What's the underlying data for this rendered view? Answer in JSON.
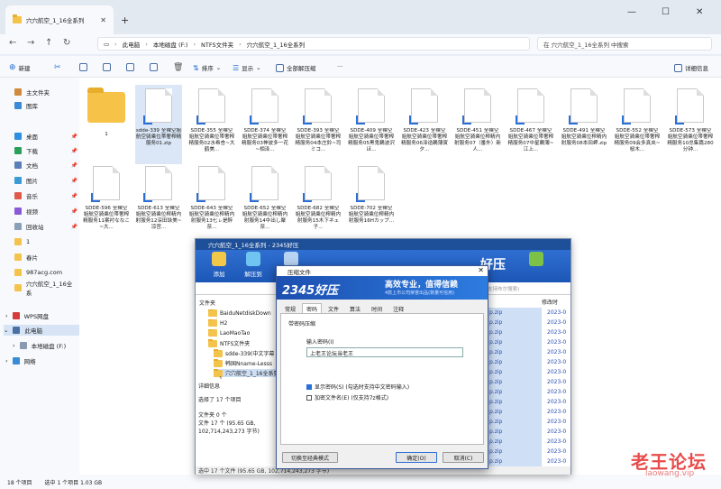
{
  "explorer": {
    "tab_title": "穴穴航空_1_16全系列",
    "new_tab": "+",
    "win_min": "—",
    "win_max": "☐",
    "win_close": "✕",
    "tab_close": "✕",
    "breadcrumbs": [
      "此电脑",
      "本地磁盘 (F:)",
      "NTFS文件夹",
      "穴穴航空_1_16全系列"
    ],
    "search_placeholder": "在 穴穴航空_1_16全系列 中搜索",
    "toolbar": {
      "new": "新建",
      "sort": "排序",
      "view": "显示",
      "extract_all": "全部解压缩",
      "details": "详细信息",
      "more": "···"
    },
    "sidebar": {
      "home": "主文件夹",
      "gallery": "图库",
      "desktop": "桌面",
      "downloads": "下载",
      "documents": "文档",
      "pictures": "图片",
      "music": "音乐",
      "videos": "视频",
      "recycle": "回收站",
      "folder1": "1",
      "folder_spring": "春片",
      "folder_987": "987acg.com",
      "folder_series": "穴穴航空_1_16全系",
      "wps": "WPS网盘",
      "this_pc": "此电脑",
      "local_disk": "本地磁盘 (F:)",
      "network": "网络"
    },
    "files": [
      {
        "name": "1"
      },
      {
        "name": "sdde-339 全裸空姐航空骑乘位帯奢榨精服务01.zip"
      },
      {
        "name": "SDDE-355 全裸空姐航空骑乘位帯奢榨精服务02水希杏~大鹤美..."
      },
      {
        "name": "SDDE-374 全裸空姐航空骑乘位帯奢榨精服务03神波多一花~相泽..."
      },
      {
        "name": "SDDE-393 全裸空姐航空骑乘位帯奢榨精服务04本庄鈴~司ミコ..."
      },
      {
        "name": "SDDE-409 全裸空姐航空骑乘位帯奢榨精服务05黑鬼鶫波沢ほ..."
      },
      {
        "name": "SDDE-423 全裸空姐航空骑乘位帯奢榨精服务06泽诰鶫薄寅夕..."
      },
      {
        "name": "SDDE-451 全裸空姐航空骑乘位榨精内射服务07（番外）新人..."
      },
      {
        "name": "SDDE-467 全裸空姐航空骑乘位帯奢榨精服务07中星鶫薄~江上..."
      },
      {
        "name": "SDDE-491 全裸空姐航空骑乘位榨精内射服务08本田岬.zip"
      },
      {
        "name": "SDDE-552 全裸空姐航空骑乘位帯奢榨精服务09会多真央~桜木..."
      },
      {
        "name": "SDDE-573 全裸空姐航空骑乘位帯奢榨精服务10总集篇280分钟..."
      },
      {
        "name": "SDDE-596 全裸空姐航空骑乘位帯奢榨精服务11案衬ななこ~大..."
      },
      {
        "name": "SDDE-613 全裸空姐航空骑乘位榨精内射服务12深田詠美~凉宫..."
      },
      {
        "name": "SDDE-643 全裸空姐航空骑乘位榨精内射服务13七ㇾ是醉奈..."
      },
      {
        "name": "SDDE-652 全裸空姐航空骑乘位榨精内射服务14中出し聚奈..."
      },
      {
        "name": "SDDE-682 全裸空姐航空骑乘位榨精内射服务15木下ネェ子..."
      },
      {
        "name": "SDDE-702 全裸空姐航空骑乘位榨精内射服务16Hカップ..."
      }
    ],
    "status": [
      "18 个项目",
      "选中 1 个项目 1.03 GB"
    ]
  },
  "haozip": {
    "title": "穴穴航空_1_16全系列 - 2345好压",
    "tools": [
      "添加",
      "解压到"
    ],
    "brand": "好压",
    "tree": [
      "BaiduNetdiskDown",
      "H2",
      "LaoMaoTao",
      "NTFS文件夹",
      "sdde-339(中文字幕",
      "韩国Nname-Lesss",
      "穴穴航空_1_16全系列",
      "1"
    ],
    "tree_header": "文件夹",
    "list_header": [
      "",
      "修改时"
    ],
    "list_rows": [
      {
        "n": "p.zip",
        "d": "2023-0"
      },
      {
        "n": "p.zip",
        "d": "2023-0"
      },
      {
        "n": "p.zip",
        "d": "2023-0"
      },
      {
        "n": "p.zip",
        "d": "2023-0"
      },
      {
        "n": "p.zip",
        "d": "2023-0"
      },
      {
        "n": "p.zip",
        "d": "2023-0"
      },
      {
        "n": "p.zip",
        "d": "2023-0"
      },
      {
        "n": "p.zip",
        "d": "2023-0"
      },
      {
        "n": "p.zip",
        "d": "2023-0"
      },
      {
        "n": "p.zip",
        "d": "2023-0"
      },
      {
        "n": "p.zip",
        "d": "2023-0"
      },
      {
        "n": "p.zip",
        "d": "2023-0"
      },
      {
        "n": "p.zip",
        "d": "2023-0"
      },
      {
        "n": "p.zip",
        "d": "2023-0"
      },
      {
        "n": "p.zip",
        "d": "2023-0"
      },
      {
        "n": "p.zip",
        "d": "2023-0"
      }
    ],
    "search_hint": "(支持布尔搜索)",
    "detail": {
      "title": "详细信息",
      "selected": "选择了 17 个项目",
      "folders": "文件夹 0 个",
      "files": "文件 17 个 (95.65 GB,",
      "bytes": "102,714,243,273 字节)"
    },
    "status": "选中 17 个文件 (95.65 GB, 102,714,243,273 字节)"
  },
  "dialog": {
    "title": "压缩文件",
    "logo": "2345好压",
    "slogan": "高效专业，值得信赖",
    "sub": "4款上市公司荣誉出品(数量可信用)",
    "tabs": [
      "常规",
      "密码",
      "文件",
      "算法",
      "时间",
      "注释"
    ],
    "section": "带密码压缩",
    "pwd_label": "输入密码(I)",
    "pwd_value": "上老王论坛当老王",
    "show_pwd": "显示密码(S)  (勾选时支持中文密码输入)",
    "encrypt_name": "加密文件名(E)  (仅支持7z格式)",
    "btn_classic": "切换至经典模式",
    "btn_ok": "确定(O)",
    "btn_cancel": "取消(C)"
  },
  "watermark": {
    "main": "老王论坛",
    "url": "laowang.vip"
  }
}
